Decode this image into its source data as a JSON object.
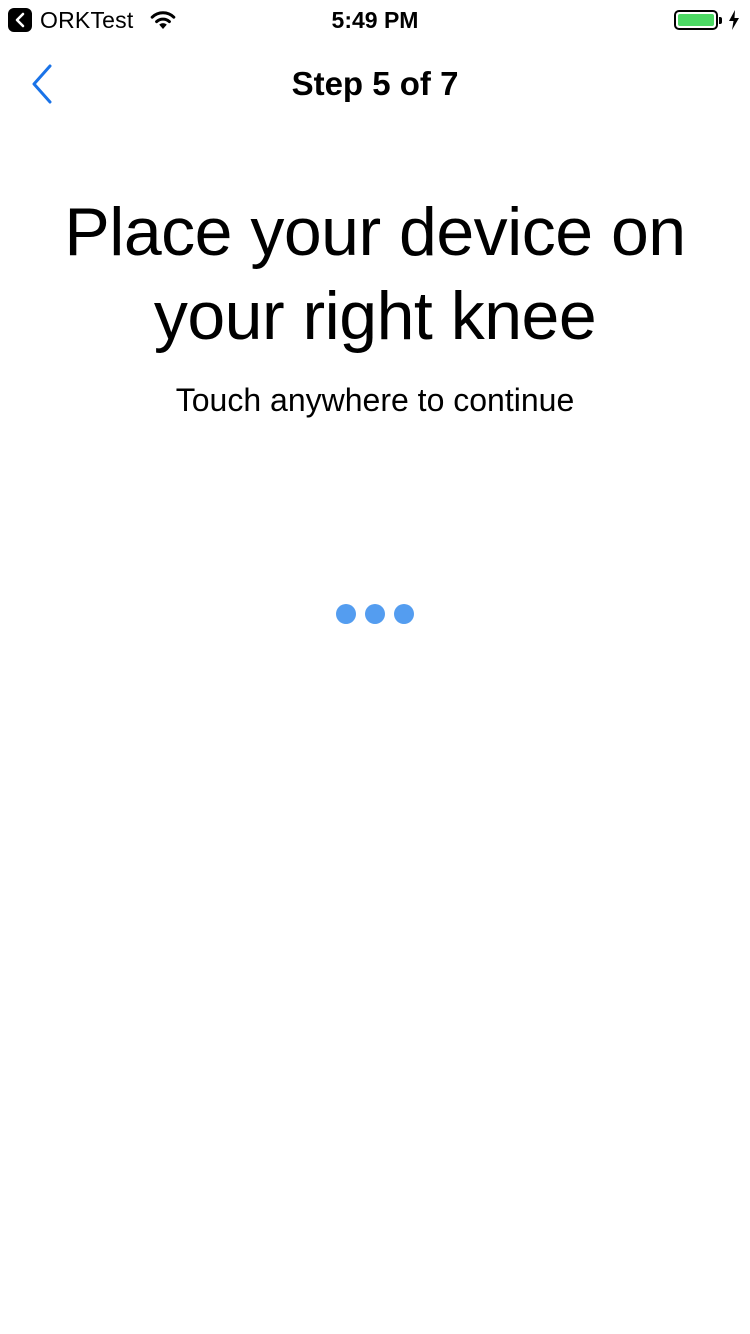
{
  "status_bar": {
    "back_app_label": "ORKTest",
    "time": "5:49 PM",
    "battery_color": "#4cd964",
    "icons": [
      "chevron-left-icon",
      "wifi-icon",
      "battery-icon",
      "charging-bolt-icon"
    ]
  },
  "nav": {
    "title": "Step 5 of 7",
    "back_icon": "chevron-left-icon",
    "accent_color": "#1a73e8"
  },
  "content": {
    "headline": "Place your device on your right knee",
    "instruction": "Touch anywhere to continue",
    "activity_indicator": "three-dot-loading",
    "dot_color": "#549df0"
  }
}
